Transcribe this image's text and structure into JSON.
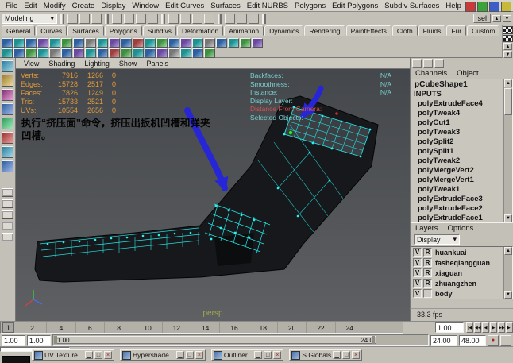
{
  "colors": {
    "ui_gray": "#c3c0b8",
    "viewport_top": "#44474b",
    "wireframe_cyan": "#22e6e6",
    "hud_orange": "#e29b3d",
    "hud_teal": "#79d2cf",
    "annotation_arrow_blue": "#2626d6",
    "selected_vertex_green": "#33e833"
  },
  "menubar": {
    "items": [
      "File",
      "Edit",
      "Modify",
      "Create",
      "Display",
      "Window",
      "Edit Curves",
      "Surfaces",
      "Edit NURBS",
      "Polygons",
      "Edit Polygons",
      "Subdiv Surfaces",
      "Help"
    ]
  },
  "statusline": {
    "mode": "Modeling",
    "sel": "sel"
  },
  "shelf": {
    "tabs": [
      "General",
      "Curves",
      "Surfaces",
      "Polygons",
      "Subdivs",
      "Deformation",
      "Animation",
      "Dynamics",
      "Rendering",
      "PaintEffects",
      "Cloth",
      "Fluids",
      "Fur",
      "Custom"
    ]
  },
  "panel": {
    "menus": [
      "View",
      "Shading",
      "Lighting",
      "Show",
      "Panels"
    ]
  },
  "viewport": {
    "stats": {
      "rows": [
        {
          "label": "Verts:",
          "total": "7916",
          "selected": "1266",
          "extra": "0"
        },
        {
          "label": "Edges:",
          "total": "15728",
          "selected": "2517",
          "extra": "0"
        },
        {
          "label": "Faces:",
          "total": "7826",
          "selected": "1249",
          "extra": "0"
        },
        {
          "label": "Tris:",
          "total": "15733",
          "selected": "2521",
          "extra": "0"
        },
        {
          "label": "UVs:",
          "total": "10554",
          "selected": "2656",
          "extra": "0"
        }
      ]
    },
    "object_details": [
      {
        "label": "Backfaces:",
        "value": "N/A"
      },
      {
        "label": "Smoothness:",
        "value": "N/A"
      },
      {
        "label": "Instance:",
        "value": "N/A"
      },
      {
        "label": "Display Layer:",
        "value": ""
      },
      {
        "label": "Distance From Camera:",
        "value": ""
      },
      {
        "label": "Selected Objects:",
        "value": ""
      }
    ],
    "annotation": "执行“挤压面”命令，挤压出扳机凹槽和弹夹\n凹槽。",
    "camera_label": "persp",
    "fps": "33.3 fps"
  },
  "channel_box": {
    "menus": [
      "Channels",
      "Object"
    ],
    "node": "pCubeShape1",
    "section": "INPUTS",
    "inputs": [
      "polyExtrudeFace4",
      "polyTweak4",
      "polyCut1",
      "polyTweak3",
      "polySplit2",
      "polySplit1",
      "polyTweak2",
      "polyMergeVert2",
      "polyMergeVert1",
      "polyTweak1",
      "polyExtrudeFace3",
      "polyExtrudeFace2",
      "polyExtrudeFace1"
    ]
  },
  "layers": {
    "menus": [
      "Layers",
      "Options"
    ],
    "display": "Display",
    "rows": [
      {
        "v": "V",
        "r": "R",
        "name": "huankuai"
      },
      {
        "v": "V",
        "r": "R",
        "name": "fasheqiangguan"
      },
      {
        "v": "V",
        "r": "R",
        "name": "xiaguan"
      },
      {
        "v": "V",
        "r": "R",
        "name": "zhuangzhen"
      },
      {
        "v": "V",
        "r": "",
        "name": "body"
      }
    ]
  },
  "timeline": {
    "ticks": [
      "2",
      "4",
      "6",
      "8",
      "10",
      "12",
      "14",
      "16",
      "18",
      "20",
      "22",
      "24"
    ],
    "current_frame": "1",
    "current_time": "1.00",
    "transport": [
      "|◀",
      "◀◀",
      "◀",
      "▶",
      "▶▶",
      "▶|"
    ]
  },
  "range": {
    "playback_start": "1.00",
    "anim_start": "1.00",
    "slider_start_label": "1.00",
    "slider_end_label": "24.0",
    "anim_end": "24.00",
    "playback_end": "48.00"
  },
  "taskbar": {
    "windows": [
      {
        "title": "UV Texture..."
      },
      {
        "title": "Hypershade..."
      },
      {
        "title": "Outliner..."
      },
      {
        "title": "S.Globals"
      }
    ]
  }
}
